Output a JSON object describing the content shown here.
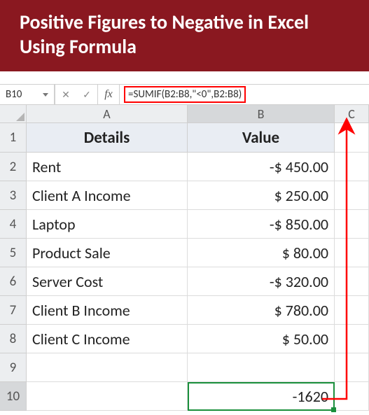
{
  "banner": {
    "title": "Positive Figures to Negative in Excel Using Formula"
  },
  "formula_bar": {
    "cell_ref": "B10",
    "cancel_glyph": "✕",
    "accept_glyph": "✓",
    "fx_label": "fx",
    "formula": "=SUMIF(B2:B8,\"<0\",B2:B8)"
  },
  "columns": [
    "A",
    "B",
    "C"
  ],
  "row_numbers": [
    "1",
    "2",
    "3",
    "4",
    "5",
    "6",
    "7",
    "8",
    "9",
    "10"
  ],
  "headers": {
    "details": "Details",
    "value": "Value"
  },
  "rows": [
    {
      "details": "Rent",
      "value": "-$ 450.00"
    },
    {
      "details": "Client A Income",
      "value": "$ 250.00"
    },
    {
      "details": "Laptop",
      "value": "-$ 850.00"
    },
    {
      "details": "Product Sale",
      "value": "$ 80.00"
    },
    {
      "details": "Server Cost",
      "value": "-$ 320.00"
    },
    {
      "details": "Client B Income",
      "value": "$ 780.00"
    },
    {
      "details": "Client C Income",
      "value": "$ 50.00"
    }
  ],
  "result": {
    "value": "-1620"
  },
  "chart_data": {
    "type": "table",
    "title": "Positive Figures to Negative in Excel Using Formula",
    "columns": [
      "Details",
      "Value"
    ],
    "rows": [
      [
        "Rent",
        -450.0
      ],
      [
        "Client A Income",
        250.0
      ],
      [
        "Laptop",
        -850.0
      ],
      [
        "Product Sale",
        80.0
      ],
      [
        "Server Cost",
        -320.0
      ],
      [
        "Client B Income",
        780.0
      ],
      [
        "Client C Income",
        50.0
      ]
    ],
    "formula": "=SUMIF(B2:B8,\"<0\",B2:B8)",
    "result_cell": "B10",
    "result_value": -1620
  }
}
